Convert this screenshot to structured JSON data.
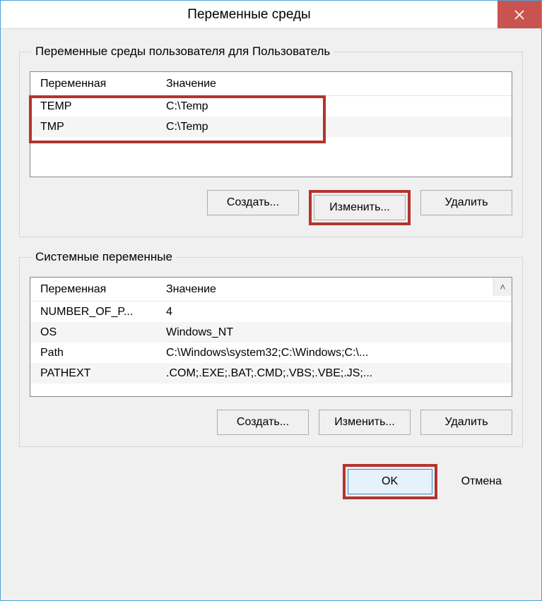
{
  "window": {
    "title": "Переменные среды"
  },
  "user_section": {
    "legend": "Переменные среды пользователя для Пользователь",
    "col_var": "Переменная",
    "col_val": "Значение",
    "rows": [
      {
        "name": "TEMP",
        "value": "C:\\Temp"
      },
      {
        "name": "TMP",
        "value": "C:\\Temp"
      }
    ],
    "btn_create": "Создать...",
    "btn_edit": "Изменить...",
    "btn_delete": "Удалить"
  },
  "system_section": {
    "legend": "Системные переменные",
    "col_var": "Переменная",
    "col_val": "Значение",
    "rows": [
      {
        "name": "NUMBER_OF_P...",
        "value": "4"
      },
      {
        "name": "OS",
        "value": "Windows_NT"
      },
      {
        "name": "Path",
        "value": "C:\\Windows\\system32;C:\\Windows;C:\\..."
      },
      {
        "name": "PATHEXT",
        "value": ".COM;.EXE;.BAT;.CMD;.VBS;.VBE;.JS;..."
      }
    ],
    "btn_create": "Создать...",
    "btn_edit": "Изменить...",
    "btn_delete": "Удалить"
  },
  "footer": {
    "ok": "OK",
    "cancel": "Отмена"
  }
}
